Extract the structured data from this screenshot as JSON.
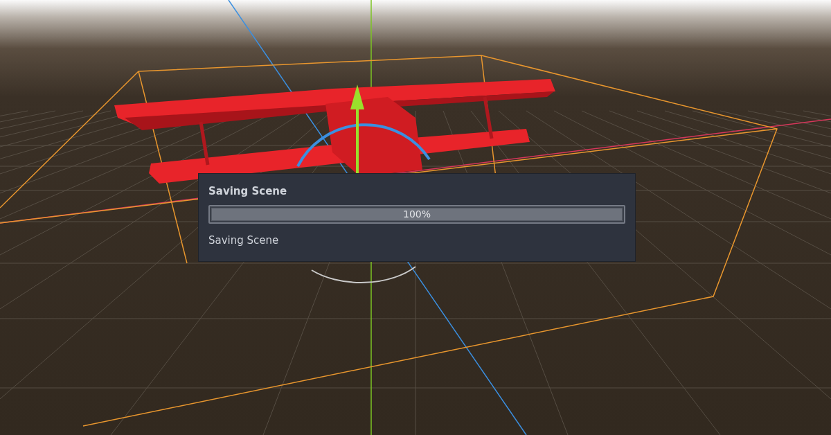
{
  "dialog": {
    "title": "Saving Scene",
    "progress": {
      "level": 1,
      "reading": "100%"
    },
    "status": "Saving Scene"
  }
}
